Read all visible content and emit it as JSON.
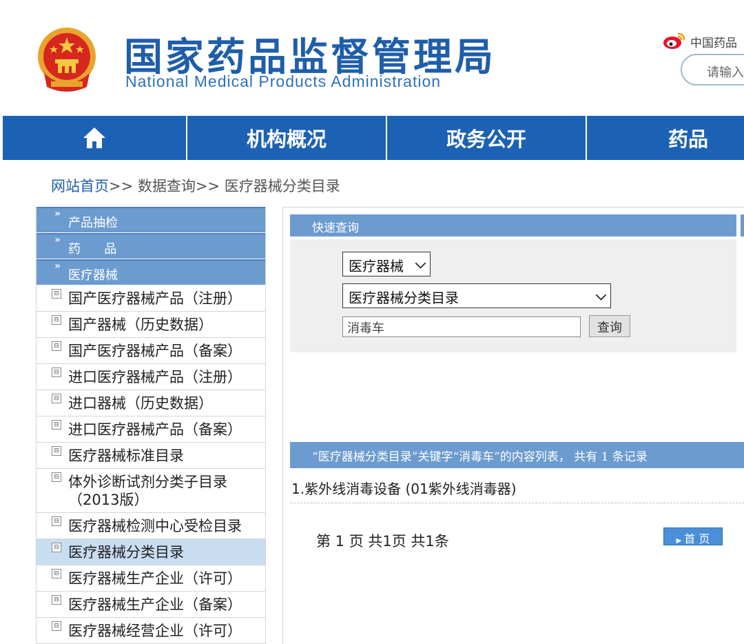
{
  "header": {
    "title_cn": "国家药品监督管理局",
    "title_en": "National Medical Products Administration",
    "weibo_text": "中国药品",
    "search_placeholder": "请输入"
  },
  "nav": {
    "items": [
      {
        "label": ""
      },
      {
        "label": "机构概况"
      },
      {
        "label": "政务公开"
      },
      {
        "label": "药品"
      }
    ]
  },
  "breadcrumb": {
    "home": "网站首页",
    "rest": ">> 数据查询>> 医疗器械分类目录"
  },
  "sidebar": {
    "marks": "»",
    "categories": [
      "产品抽检",
      "药      品",
      "医疗器械"
    ],
    "items": [
      {
        "label": "国产医疗器械产品（注册）"
      },
      {
        "label": "国产器械（历史数据）"
      },
      {
        "label": "国产医疗器械产品（备案）"
      },
      {
        "label": "进口医疗器械产品（注册）"
      },
      {
        "label": "进口器械（历史数据）"
      },
      {
        "label": "进口医疗器械产品（备案）"
      },
      {
        "label": "医疗器械标准目录"
      },
      {
        "label": "体外诊断试剂分类子目录（2013版）"
      },
      {
        "label": "医疗器械检测中心受检目录"
      },
      {
        "label": "医疗器械分类目录",
        "active": true
      },
      {
        "label": "医疗器械生产企业（许可）"
      },
      {
        "label": "医疗器械生产企业（备案）"
      },
      {
        "label": "医疗器械经营企业（许可）"
      }
    ]
  },
  "quick_search": {
    "title": "快速查询",
    "select_category": "医疗器械",
    "select_database": "医疗器械分类目录",
    "keyword": "消毒车",
    "query_label": "查询"
  },
  "results": {
    "header": "“医疗器械分类目录”关键字“消毒车”的内容列表， 共有 1 条记录",
    "items": [
      "1.紫外线消毒设备 (01紫外线消毒器)"
    ],
    "pager_info": "第 1 页 共1页 共1条",
    "first_page_label": "首 页"
  },
  "colors": {
    "nav_blue": "#1c62b4",
    "panel_blue": "#6c9bcf",
    "brand_blue": "#1f5ea9",
    "active_row": "#c9ddf2"
  }
}
